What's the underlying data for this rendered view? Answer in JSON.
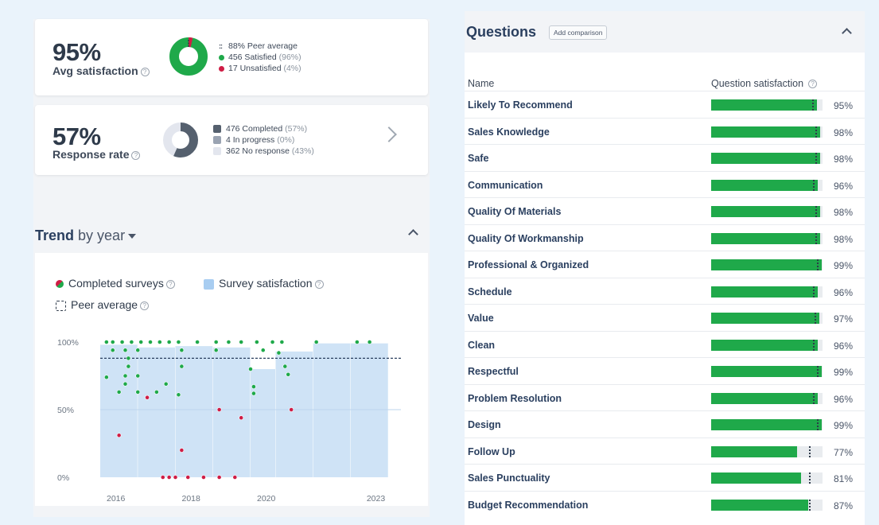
{
  "satisfaction": {
    "value": "95%",
    "label": "Avg satisfaction",
    "donut": {
      "satisfied": 456,
      "unsatisfied": 17
    },
    "legend": [
      {
        "text": "88% Peer average",
        "muted": "",
        "marker": "dots"
      },
      {
        "text": "456 Satisfied",
        "muted": " (96%)",
        "marker": "green"
      },
      {
        "text": "17 Unsatisfied",
        "muted": " (4%)",
        "marker": "red"
      }
    ]
  },
  "response": {
    "value": "57%",
    "label": "Response rate",
    "donut": {
      "completed": 476,
      "in_progress": 4,
      "no_response": 362
    },
    "legend": [
      {
        "text": "476 Completed",
        "muted": " (57%)"
      },
      {
        "text": "4 In progress",
        "muted": " (0%)"
      },
      {
        "text": "362 No response",
        "muted": " (43%)"
      }
    ]
  },
  "trend": {
    "title": "Trend",
    "subtitle": "by year",
    "legend": {
      "completed": "Completed surveys",
      "satisfaction": "Survey satisfaction",
      "peer": "Peer average"
    }
  },
  "colors": {
    "green": "#1fa94a",
    "red": "#cf1d45",
    "dark_slate": "#55606e",
    "mid_slate": "#9aa3b2",
    "light_slate": "#e3e6ee",
    "bar_blue": "#cfe3f6"
  },
  "chart_data": {
    "type": "bar",
    "x_ticks": [
      "2016",
      "2018",
      "2020",
      "2023"
    ],
    "y_ticks": [
      "100%",
      "50%",
      "0%"
    ],
    "ylim": [
      0,
      100
    ],
    "peer_average": 88,
    "bars": [
      {
        "start": "2016-01",
        "end": "2017-01",
        "value": 98
      },
      {
        "start": "2017-01",
        "end": "2018-01",
        "value": 96
      },
      {
        "start": "2018-01",
        "end": "2019-01",
        "value": 97
      },
      {
        "start": "2019-01",
        "end": "2020-01",
        "value": 96
      },
      {
        "start": "2020-01",
        "end": "2020-09",
        "value": 80
      },
      {
        "start": "2020-09",
        "end": "2021-09",
        "value": 93
      },
      {
        "start": "2021-09",
        "end": "2022-09",
        "value": 99
      },
      {
        "start": "2022-09",
        "end": "2023-09",
        "value": 99
      }
    ],
    "surveys": [
      {
        "date": "2016-03",
        "value": 100,
        "status": "satisfied"
      },
      {
        "date": "2016-05",
        "value": 100,
        "status": "satisfied"
      },
      {
        "date": "2016-08",
        "value": 100,
        "status": "satisfied"
      },
      {
        "date": "2016-11",
        "value": 100,
        "status": "satisfied"
      },
      {
        "date": "2017-02",
        "value": 100,
        "status": "satisfied"
      },
      {
        "date": "2017-05",
        "value": 100,
        "status": "satisfied"
      },
      {
        "date": "2017-08",
        "value": 100,
        "status": "satisfied"
      },
      {
        "date": "2017-11",
        "value": 100,
        "status": "satisfied"
      },
      {
        "date": "2018-02",
        "value": 100,
        "status": "satisfied"
      },
      {
        "date": "2018-08",
        "value": 100,
        "status": "satisfied"
      },
      {
        "date": "2019-02",
        "value": 100,
        "status": "satisfied"
      },
      {
        "date": "2019-06",
        "value": 100,
        "status": "satisfied"
      },
      {
        "date": "2019-10",
        "value": 100,
        "status": "satisfied"
      },
      {
        "date": "2020-03",
        "value": 100,
        "status": "satisfied"
      },
      {
        "date": "2020-08",
        "value": 100,
        "status": "satisfied"
      },
      {
        "date": "2020-11",
        "value": 100,
        "status": "satisfied"
      },
      {
        "date": "2021-10",
        "value": 100,
        "status": "satisfied"
      },
      {
        "date": "2022-11",
        "value": 100,
        "status": "satisfied"
      },
      {
        "date": "2023-03",
        "value": 100,
        "status": "satisfied"
      },
      {
        "date": "2016-05",
        "value": 94,
        "status": "satisfied"
      },
      {
        "date": "2016-09",
        "value": 94,
        "status": "satisfied"
      },
      {
        "date": "2017-01",
        "value": 94,
        "status": "satisfied"
      },
      {
        "date": "2018-03",
        "value": 94,
        "status": "satisfied"
      },
      {
        "date": "2019-02",
        "value": 94,
        "status": "satisfied"
      },
      {
        "date": "2020-05",
        "value": 94,
        "status": "satisfied"
      },
      {
        "date": "2020-10",
        "value": 92,
        "status": "satisfied"
      },
      {
        "date": "2016-10",
        "value": 88,
        "status": "satisfied"
      },
      {
        "date": "2016-10",
        "value": 82,
        "status": "satisfied"
      },
      {
        "date": "2018-03",
        "value": 82,
        "status": "satisfied"
      },
      {
        "date": "2020-12",
        "value": 82,
        "status": "satisfied"
      },
      {
        "date": "2016-03",
        "value": 74,
        "status": "satisfied"
      },
      {
        "date": "2016-09",
        "value": 75,
        "status": "satisfied"
      },
      {
        "date": "2017-01",
        "value": 75,
        "status": "satisfied"
      },
      {
        "date": "2020-01",
        "value": 80,
        "status": "satisfied"
      },
      {
        "date": "2021-01",
        "value": 76,
        "status": "satisfied"
      },
      {
        "date": "2016-09",
        "value": 69,
        "status": "satisfied"
      },
      {
        "date": "2017-10",
        "value": 69,
        "status": "satisfied"
      },
      {
        "date": "2020-02",
        "value": 67,
        "status": "satisfied"
      },
      {
        "date": "2016-07",
        "value": 63,
        "status": "satisfied"
      },
      {
        "date": "2017-01",
        "value": 63,
        "status": "satisfied"
      },
      {
        "date": "2017-07",
        "value": 63,
        "status": "satisfied"
      },
      {
        "date": "2018-02",
        "value": 61,
        "status": "satisfied"
      },
      {
        "date": "2020-02",
        "value": 62,
        "status": "satisfied"
      },
      {
        "date": "2017-04",
        "value": 59,
        "status": "unsatisfied"
      },
      {
        "date": "2019-03",
        "value": 50,
        "status": "unsatisfied"
      },
      {
        "date": "2019-10",
        "value": 44,
        "status": "unsatisfied"
      },
      {
        "date": "2021-02",
        "value": 50,
        "status": "unsatisfied"
      },
      {
        "date": "2016-07",
        "value": 31,
        "status": "unsatisfied"
      },
      {
        "date": "2018-03",
        "value": 20,
        "status": "unsatisfied"
      },
      {
        "date": "2017-09",
        "value": 0,
        "status": "unsatisfied"
      },
      {
        "date": "2017-11",
        "value": 0,
        "status": "unsatisfied"
      },
      {
        "date": "2018-01",
        "value": 0,
        "status": "unsatisfied"
      },
      {
        "date": "2018-05",
        "value": 0,
        "status": "unsatisfied"
      },
      {
        "date": "2018-10",
        "value": 0,
        "status": "unsatisfied"
      },
      {
        "date": "2019-03",
        "value": 0,
        "status": "unsatisfied"
      },
      {
        "date": "2019-08",
        "value": 0,
        "status": "unsatisfied"
      }
    ]
  },
  "questions": {
    "title": "Questions",
    "add_comparison": "Add comparison",
    "col_name": "Name",
    "col_satisfaction": "Question satisfaction",
    "rows": [
      {
        "name": "Likely To Recommend",
        "pct": "95%",
        "value": 95
      },
      {
        "name": "Sales Knowledge",
        "pct": "98%",
        "value": 98
      },
      {
        "name": "Safe",
        "pct": "98%",
        "value": 98
      },
      {
        "name": "Communication",
        "pct": "96%",
        "value": 96
      },
      {
        "name": "Quality Of Materials",
        "pct": "98%",
        "value": 98
      },
      {
        "name": "Quality Of Workmanship",
        "pct": "98%",
        "value": 98
      },
      {
        "name": "Professional & Organized",
        "pct": "99%",
        "value": 99
      },
      {
        "name": "Schedule",
        "pct": "96%",
        "value": 96
      },
      {
        "name": "Value",
        "pct": "97%",
        "value": 97
      },
      {
        "name": "Clean",
        "pct": "96%",
        "value": 96
      },
      {
        "name": "Respectful",
        "pct": "99%",
        "value": 99
      },
      {
        "name": "Problem Resolution",
        "pct": "96%",
        "value": 96
      },
      {
        "name": "Design",
        "pct": "99%",
        "value": 99
      },
      {
        "name": "Follow Up",
        "pct": "77%",
        "value": 77
      },
      {
        "name": "Sales Punctuality",
        "pct": "81%",
        "value": 81
      },
      {
        "name": "Budget Recommendation",
        "pct": "87%",
        "value": 87
      }
    ]
  }
}
